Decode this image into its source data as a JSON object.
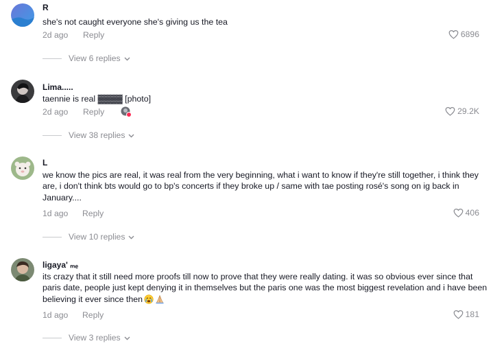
{
  "comments": [
    {
      "username": "R",
      "text": "she's not caught everyone she's giving us the tea",
      "time": "2d ago",
      "reply": "Reply",
      "likes": "6896",
      "view_replies": "View 6 replies"
    },
    {
      "username": "Lima.....",
      "text": "taennie is real ▓▓▓▓ [photo]",
      "time": "2d ago",
      "reply": "Reply",
      "likes": "29.2K",
      "view_replies": "View 38 replies"
    },
    {
      "username": "L",
      "text": "we know the pics are real, it was real from the very beginning, what i want to know if they're still together, i think they are, i don't think bts would go to bp's concerts if they broke up / same with tae posting rosé's song on ig back in January....",
      "time": "1d ago",
      "reply": "Reply",
      "likes": "406",
      "view_replies": "View 10 replies"
    },
    {
      "username": "ligaya' ₘₑ",
      "text": "its crazy that it still need more proofs till now to prove that they were really dating. it was so obvious ever since that paris date, people just kept denying it in themselves but the paris one was the most biggest revelation and i have been believing it ever since then",
      "time": "1d ago",
      "reply": "Reply",
      "likes": "181",
      "view_replies": "View 3 replies"
    }
  ],
  "icons": {
    "like": "heart-outline-icon",
    "expand": "chevron-down-icon"
  },
  "colors": {
    "text": "#161823",
    "muted": "#8a8b91"
  }
}
